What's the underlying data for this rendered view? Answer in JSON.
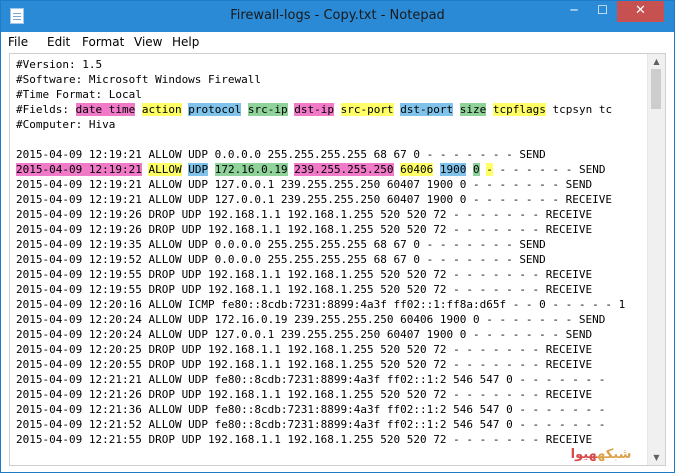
{
  "window": {
    "title": "Firewall-logs - Copy.txt - Notepad",
    "controls": {
      "minimize": "─",
      "maximize": "☐",
      "close": "✕"
    }
  },
  "menu": [
    "File",
    "Edit",
    "Format",
    "View",
    "Help"
  ],
  "colors": {
    "pink": "#f07ac8",
    "yellow": "#ffff66",
    "blue": "#7fc3ea",
    "green": "#8fd29a",
    "titlebar": "#2b8ad6"
  },
  "lines": [
    [
      {
        "t": "#Version: 1.5"
      }
    ],
    [
      {
        "t": "#Software: Microsoft Windows Firewall"
      }
    ],
    [
      {
        "t": "#Time Format: Local"
      }
    ],
    [
      {
        "t": "#Fields: "
      },
      {
        "t": "date time",
        "c": "pink"
      },
      {
        "t": " "
      },
      {
        "t": "action",
        "c": "yellow"
      },
      {
        "t": " "
      },
      {
        "t": "protocol",
        "c": "blue"
      },
      {
        "t": " "
      },
      {
        "t": "src-ip",
        "c": "green"
      },
      {
        "t": " "
      },
      {
        "t": "dst-ip",
        "c": "pink"
      },
      {
        "t": " "
      },
      {
        "t": "src-port",
        "c": "yellow"
      },
      {
        "t": " "
      },
      {
        "t": "dst-port",
        "c": "blue"
      },
      {
        "t": " "
      },
      {
        "t": "size",
        "c": "green"
      },
      {
        "t": " "
      },
      {
        "t": "tcpflags",
        "c": "yellow"
      },
      {
        "t": " tcpsyn tc"
      }
    ],
    [
      {
        "t": "#Computer: Hiva"
      }
    ],
    [
      {
        "t": ""
      }
    ],
    [
      {
        "t": "2015-04-09 12:19:21 ALLOW UDP 0.0.0.0 255.255.255.255 68 67 0 - - - - - - - SEND"
      }
    ],
    [
      {
        "t": "2015-04-09 12:19:21",
        "c": "pink"
      },
      {
        "t": " "
      },
      {
        "t": "ALLOW",
        "c": "yellow"
      },
      {
        "t": " "
      },
      {
        "t": "UDP",
        "c": "blue"
      },
      {
        "t": " "
      },
      {
        "t": "172.16.0.19",
        "c": "green"
      },
      {
        "t": " "
      },
      {
        "t": "239.255.255.250",
        "c": "pink"
      },
      {
        "t": " "
      },
      {
        "t": "60406",
        "c": "yellow"
      },
      {
        "t": " "
      },
      {
        "t": "1900",
        "c": "blue"
      },
      {
        "t": " "
      },
      {
        "t": "0",
        "c": "green"
      },
      {
        "t": " "
      },
      {
        "t": "-",
        "c": "yellow"
      },
      {
        "t": " - - - - - - SEND"
      }
    ],
    [
      {
        "t": "2015-04-09 12:19:21 ALLOW UDP 127.0.0.1 239.255.255.250 60407 1900 0 - - - - - - - SEND"
      }
    ],
    [
      {
        "t": "2015-04-09 12:19:21 ALLOW UDP 127.0.0.1 239.255.255.250 60407 1900 0 - - - - - - - RECEIVE"
      }
    ],
    [
      {
        "t": "2015-04-09 12:19:26 DROP UDP 192.168.1.1 192.168.1.255 520 520 72 - - - - - - - RECEIVE"
      }
    ],
    [
      {
        "t": "2015-04-09 12:19:26 DROP UDP 192.168.1.1 192.168.1.255 520 520 72 - - - - - - - RECEIVE"
      }
    ],
    [
      {
        "t": "2015-04-09 12:19:35 ALLOW UDP 0.0.0.0 255.255.255.255 68 67 0 - - - - - - - SEND"
      }
    ],
    [
      {
        "t": "2015-04-09 12:19:52 ALLOW UDP 0.0.0.0 255.255.255.255 68 67 0 - - - - - - - SEND"
      }
    ],
    [
      {
        "t": "2015-04-09 12:19:55 DROP UDP 192.168.1.1 192.168.1.255 520 520 72 - - - - - - - RECEIVE"
      }
    ],
    [
      {
        "t": "2015-04-09 12:19:55 DROP UDP 192.168.1.1 192.168.1.255 520 520 72 - - - - - - - RECEIVE"
      }
    ],
    [
      {
        "t": "2015-04-09 12:20:16 ALLOW ICMP fe80::8cdb:7231:8899:4a3f ff02::1:ff8a:d65f - - 0 - - - - - 1"
      }
    ],
    [
      {
        "t": "2015-04-09 12:20:24 ALLOW UDP 172.16.0.19 239.255.255.250 60406 1900 0 - - - - - - - SEND"
      }
    ],
    [
      {
        "t": "2015-04-09 12:20:24 ALLOW UDP 127.0.0.1 239.255.255.250 60407 1900 0 - - - - - - - SEND"
      }
    ],
    [
      {
        "t": "2015-04-09 12:20:25 DROP UDP 192.168.1.1 192.168.1.255 520 520 72 - - - - - - - RECEIVE"
      }
    ],
    [
      {
        "t": "2015-04-09 12:20:55 DROP UDP 192.168.1.1 192.168.1.255 520 520 72 - - - - - - - RECEIVE"
      }
    ],
    [
      {
        "t": "2015-04-09 12:21:21 ALLOW UDP fe80::8cdb:7231:8899:4a3f ff02::1:2 546 547 0 - - - - - - -"
      }
    ],
    [
      {
        "t": "2015-04-09 12:21:26 DROP UDP 192.168.1.1 192.168.1.255 520 520 72 - - - - - - - RECEIVE"
      }
    ],
    [
      {
        "t": "2015-04-09 12:21:36 ALLOW UDP fe80::8cdb:7231:8899:4a3f ff02::1:2 546 547 0 - - - - - - -"
      }
    ],
    [
      {
        "t": "2015-04-09 12:21:52 ALLOW UDP fe80::8cdb:7231:8899:4a3f ff02::1:2 546 547 0 - - - - - - -"
      }
    ],
    [
      {
        "t": "2015-04-09 12:21:55 DROP UDP 192.168.1.1 192.168.1.255 520 520 72 - - - - - - - RECEIVE"
      }
    ]
  ],
  "watermark": {
    "part1": "هیوا",
    "part2": " شبکه"
  }
}
